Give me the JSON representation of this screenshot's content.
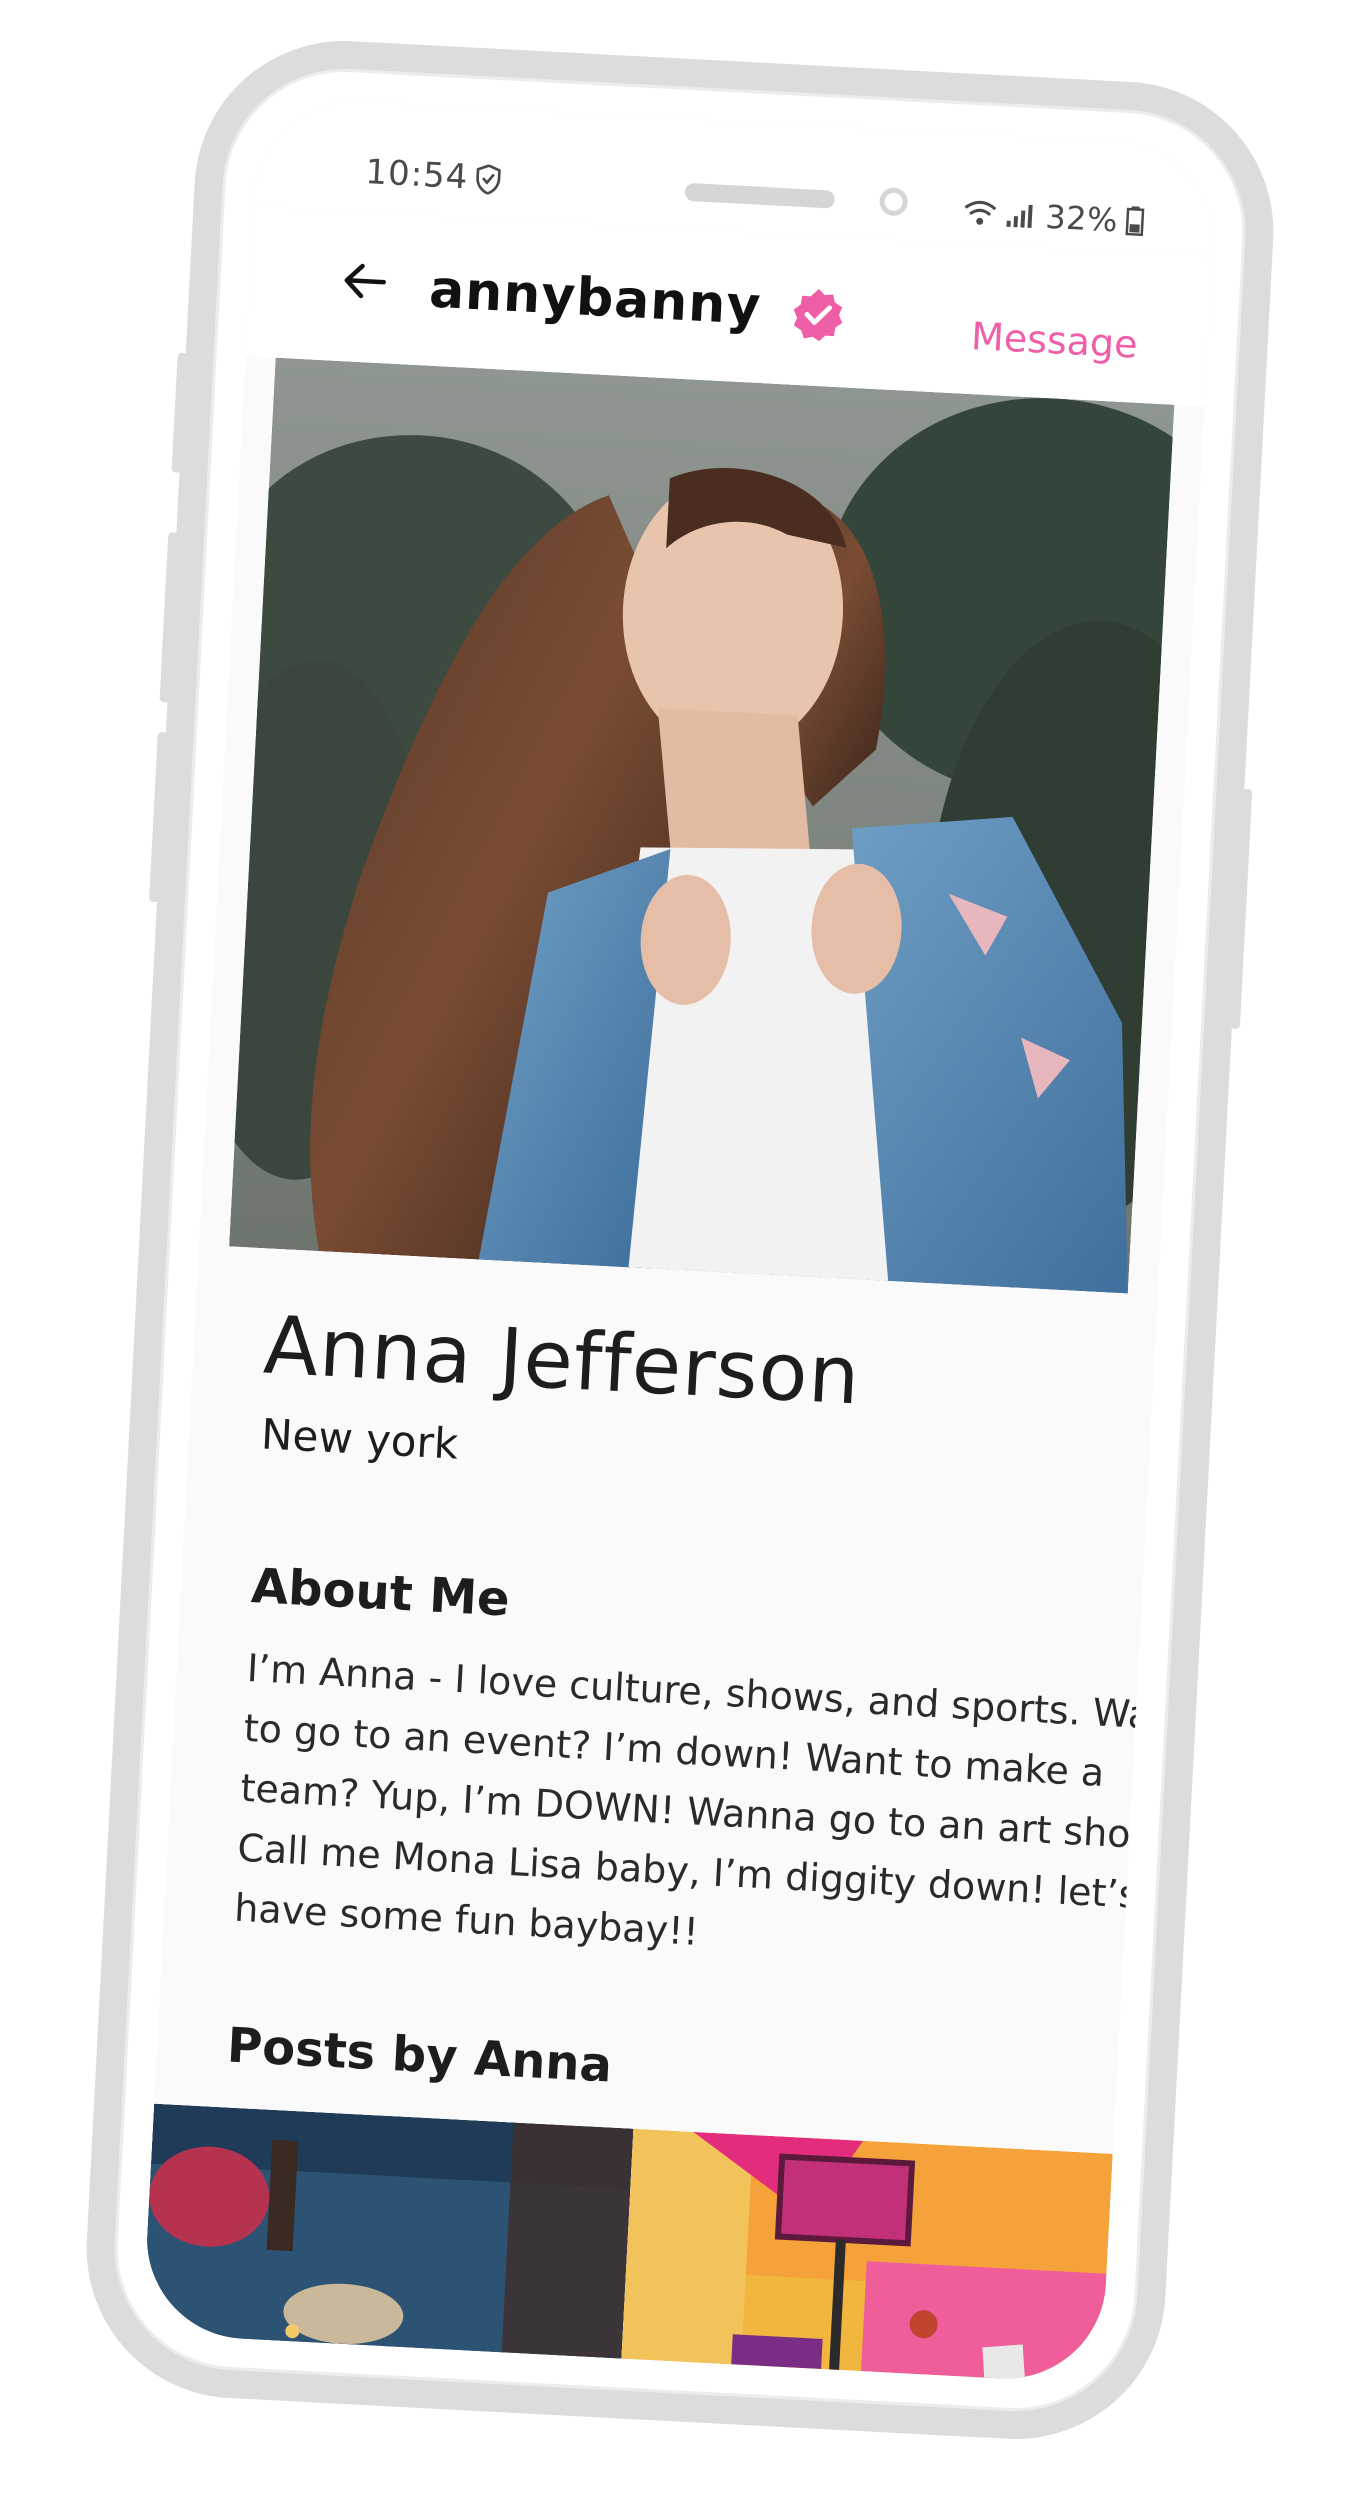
{
  "status_bar": {
    "time": "10:54",
    "battery": "32%",
    "icons": [
      "shield-icon",
      "wifi-icon",
      "signal-icon",
      "battery-icon"
    ]
  },
  "app_bar": {
    "username": "annybanny",
    "verified_icon": "verified-badge-icon",
    "back_icon": "arrow-left-icon",
    "message_label": "Message"
  },
  "profile": {
    "name": "Anna Jefferson",
    "location": "New york",
    "about_heading": "About Me",
    "about_text": "I’m Anna - I love culture, shows, and sports. Want to go to an event? I’m down! Want to make a team? Yup, I’m DOWN! Wanna go to an art show? Call me Mona Lisa baby, I’m diggity down! let’s have some fun baybay!!",
    "posts_heading": "Posts by Anna"
  },
  "colors": {
    "accent": "#ee5fa8",
    "text": "#1d1d1d",
    "frame": "#dcdcdc"
  }
}
